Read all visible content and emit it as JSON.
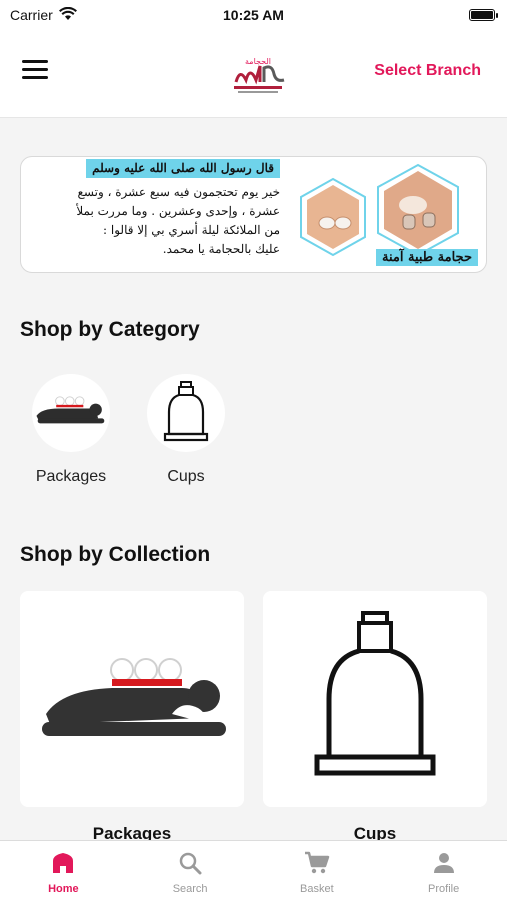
{
  "status_bar": {
    "carrier": "Carrier",
    "time": "10:25 AM"
  },
  "header": {
    "select_branch": "Select Branch",
    "logo_text": "الحجامة"
  },
  "banner": {
    "lines": [
      "قال رسول الله  صلى الله عليه وسلم",
      "خير يوم تحتجمون فيه سبع عشرة ، وتسع",
      "عشرة ، وإحدى وعشرين . وما مررت بملأ",
      "من الملائكة ليلة أسري بي إلا قالوا :",
      "عليك بالحجامة يا محمد."
    ],
    "caption": "حجامة طبية آمنة"
  },
  "sections": {
    "category_title": "Shop by Category",
    "collection_title": "Shop by Collection"
  },
  "categories": [
    {
      "label": "Packages",
      "icon": "packages-icon"
    },
    {
      "label": "Cups",
      "icon": "cup-icon"
    }
  ],
  "collections": [
    {
      "label": "Packages",
      "icon": "packages-icon"
    },
    {
      "label": "Cups",
      "icon": "cup-icon"
    }
  ],
  "tabs": [
    {
      "label": "Home",
      "icon": "home-icon",
      "active": true
    },
    {
      "label": "Search",
      "icon": "search-icon",
      "active": false
    },
    {
      "label": "Basket",
      "icon": "cart-icon",
      "active": false
    },
    {
      "label": "Profile",
      "icon": "profile-icon",
      "active": false
    }
  ],
  "colors": {
    "accent": "#e2185a",
    "banner_highlight": "#6fd3ea",
    "background": "#f4f4f4"
  }
}
